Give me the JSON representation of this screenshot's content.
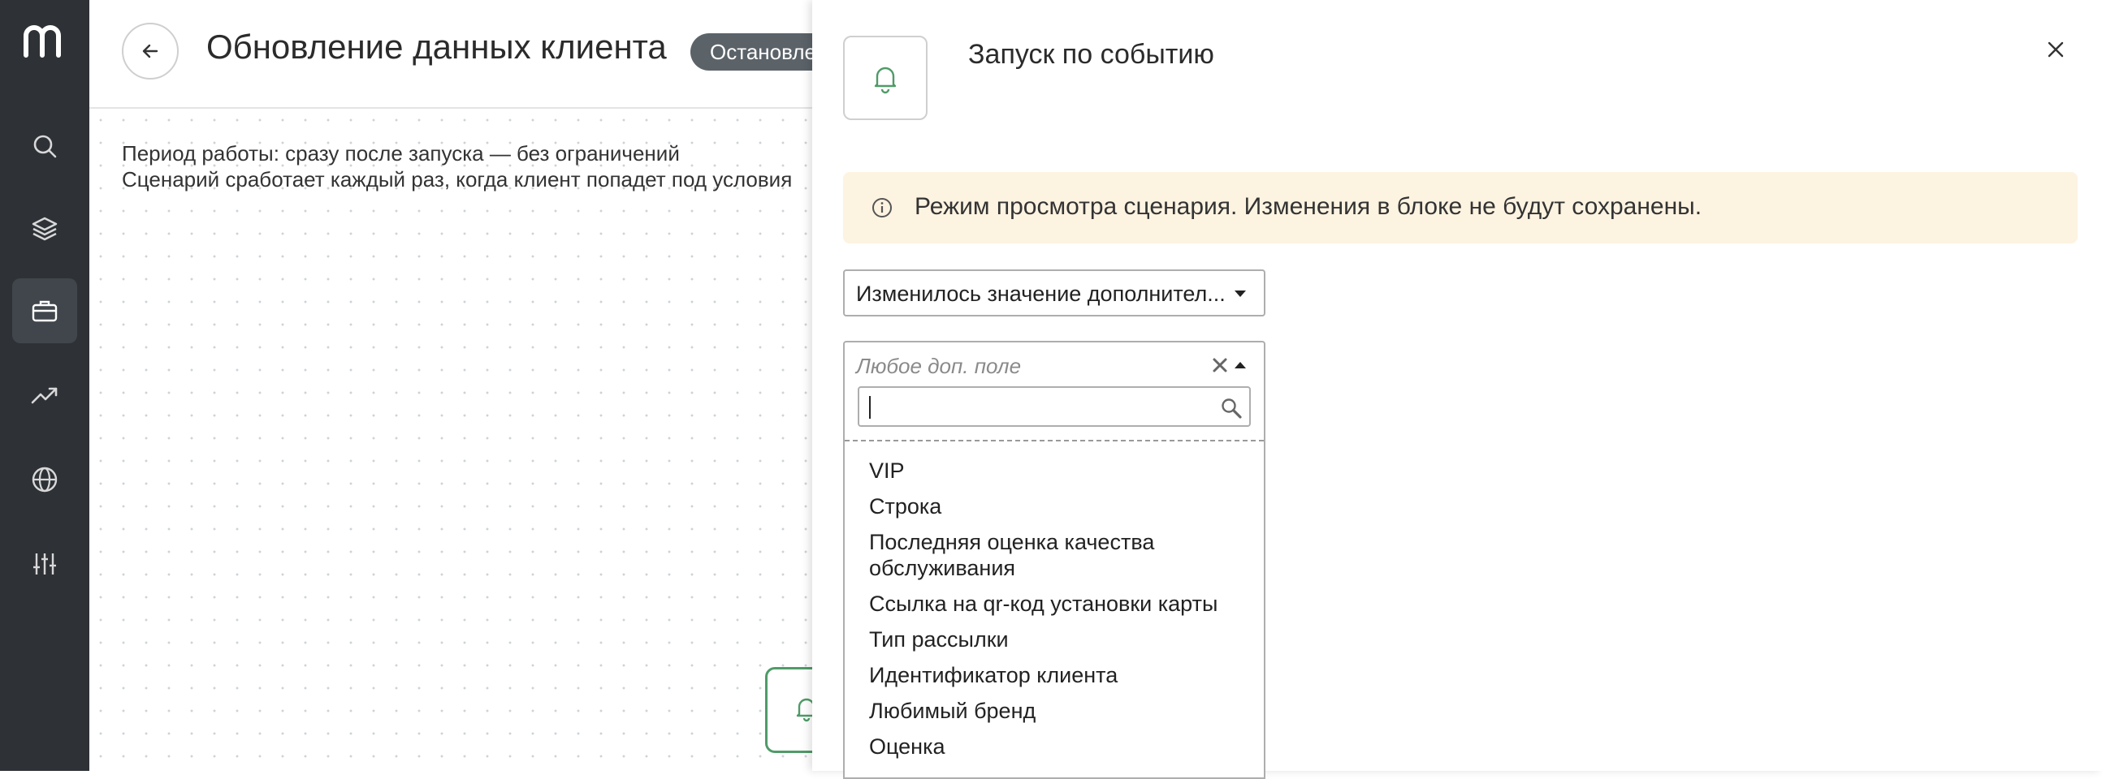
{
  "app": {
    "logo": "m",
    "nav": [
      {
        "icon": "search-icon",
        "active": false
      },
      {
        "icon": "layers-icon",
        "active": false
      },
      {
        "icon": "briefcase-icon",
        "active": true
      },
      {
        "icon": "trending-up-icon",
        "active": false
      },
      {
        "icon": "globe-icon",
        "active": false
      },
      {
        "icon": "sliders-icon",
        "active": false
      }
    ]
  },
  "header": {
    "title": "Обновление данных клиента",
    "status": "Остановлен"
  },
  "canvas": {
    "period_line": "Период работы: сразу после запуска — без ограничений",
    "trigger_line": "Сценарий сработает каждый раз, когда клиент попадет под условия"
  },
  "panel": {
    "title": "Запуск по событию",
    "notice": "Режим просмотра сценария. Изменения в блоке не будут сохранены.",
    "event_select_value": "Изменилось значение дополнител...",
    "field_dropdown": {
      "placeholder": "Любое доп. поле",
      "search_value": "",
      "options": [
        "VIP",
        "Строка",
        "Последняя оценка качества обслуживания",
        "Ссылка на qr-код установки карты",
        "Тип рассылки",
        "Идентификатор клиента",
        "Любимый бренд",
        "Оценка"
      ]
    }
  },
  "colors": {
    "nav_bg": "#2e3237",
    "accent_green": "#4f9b68",
    "notice_bg": "#fdf3e1",
    "badge_bg": "#5b6369"
  }
}
